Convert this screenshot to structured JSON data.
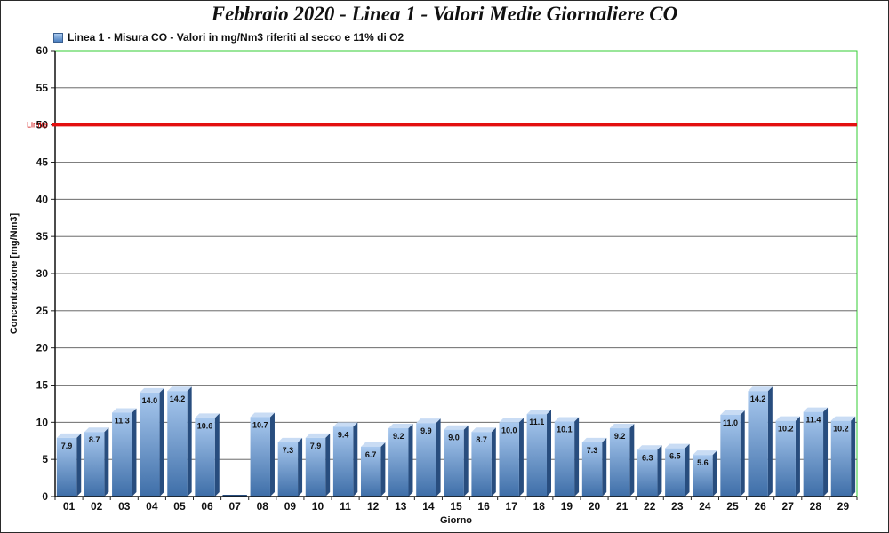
{
  "chart_data": {
    "type": "bar",
    "title": "Febbraio 2020 - Linea 1 - Valori Medie Giornaliere CO",
    "legend": "Linea 1 - Misura CO - Valori in mg/Nm3 riferiti al secco e 11% di O2",
    "legend_position": "top-left",
    "xlabel": "Giorno",
    "ylabel": "Concentrazione [mg/Nm3]",
    "ylim": [
      0,
      60
    ],
    "yticks": [
      0,
      5,
      10,
      15,
      20,
      25,
      30,
      35,
      40,
      45,
      50,
      55,
      60
    ],
    "grid": true,
    "categories": [
      "01",
      "02",
      "03",
      "04",
      "05",
      "06",
      "07",
      "08",
      "09",
      "10",
      "11",
      "12",
      "13",
      "14",
      "15",
      "16",
      "17",
      "18",
      "19",
      "20",
      "21",
      "22",
      "23",
      "24",
      "25",
      "26",
      "27",
      "28",
      "29"
    ],
    "values": [
      7.9,
      8.7,
      11.3,
      14.0,
      14.2,
      10.6,
      0,
      10.7,
      7.3,
      7.9,
      9.4,
      6.7,
      9.2,
      9.9,
      9.0,
      8.7,
      10.0,
      11.1,
      10.1,
      7.3,
      9.2,
      6.3,
      6.5,
      5.6,
      11.0,
      14.2,
      10.2,
      11.4,
      10.2
    ],
    "value_labels": [
      "7.9",
      "8.7",
      "11.3",
      "14.0",
      "14.2",
      "10.6",
      "",
      "10.7",
      "7.3",
      "7.9",
      "9.4",
      "6.7",
      "9.2",
      "9.9",
      "9.0",
      "8.7",
      "10.0",
      "11.1",
      "10.1",
      "7.3",
      "9.2",
      "6.3",
      "6.5",
      "5.6",
      "11.0",
      "14.2",
      "10.2",
      "11.4",
      "10.2"
    ],
    "limit": {
      "label": "Limite",
      "value": 50,
      "color": "#e31010"
    },
    "colors": {
      "bar_top": "#a9c9ef",
      "bar_bottom": "#3e6ea8",
      "bar_side": "#284d7e",
      "bar_cap": "#c9dcf4",
      "plot_border": "#33cc33",
      "grid": "#555555"
    }
  }
}
